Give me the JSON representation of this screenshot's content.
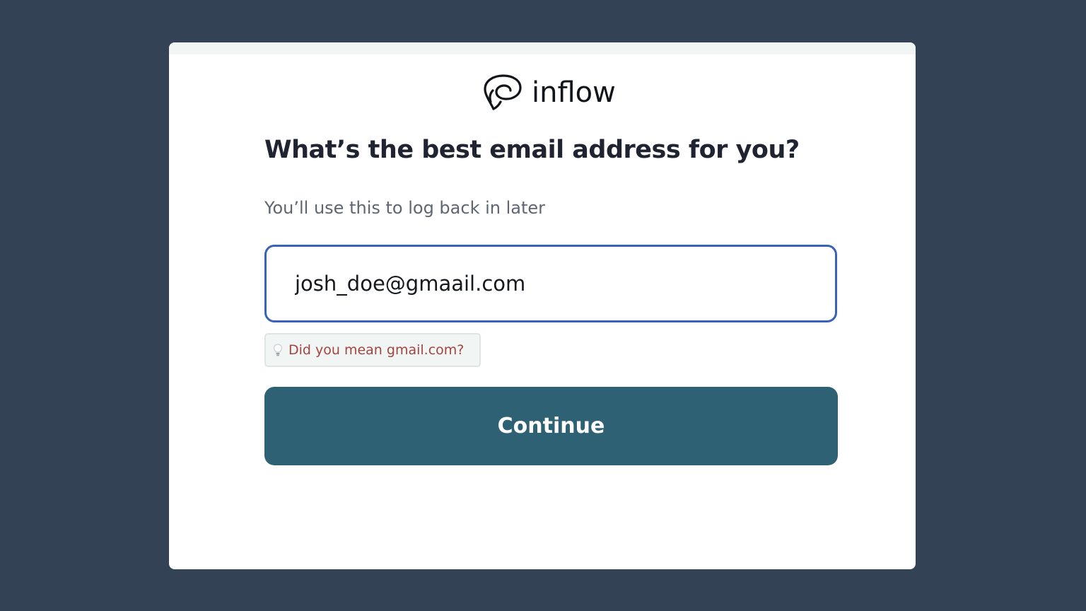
{
  "brand": {
    "name": "inflow",
    "icon": "inflow-logo-icon"
  },
  "form": {
    "title": "What’s the best email address for you?",
    "subtitle": "You’ll use this to log back in later",
    "email_value": "josh_doe@gmaail.com",
    "suggestion": {
      "icon": "lightbulb-icon",
      "text": "Did you mean gmail.com?"
    },
    "continue_label": "Continue"
  },
  "colors": {
    "background": "#344256",
    "card": "#ffffff",
    "input_border": "#3863b8",
    "suggestion_text": "#a3453f",
    "button": "#2d6173"
  }
}
